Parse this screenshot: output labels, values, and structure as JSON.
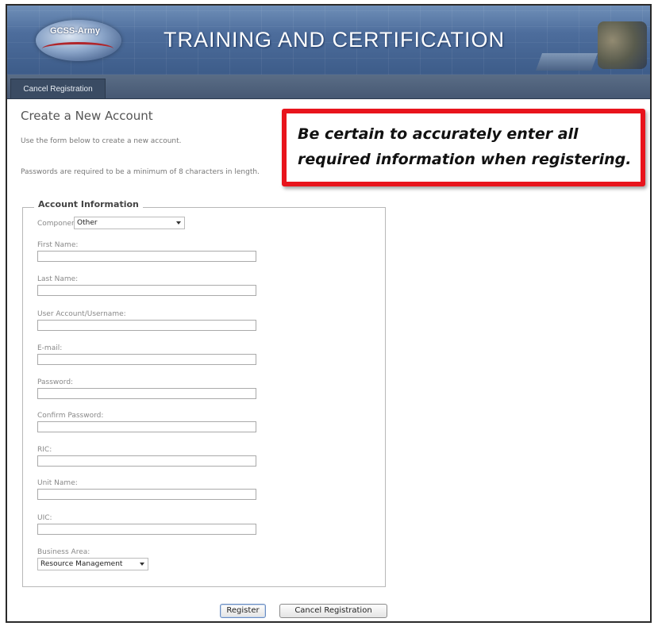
{
  "banner": {
    "logo_text": "GCSS-Army",
    "title": "TRAINING  AND CERTIFICATION"
  },
  "nav": {
    "cancel_tab": "Cancel Registration"
  },
  "page": {
    "title": "Create a New Account",
    "intro_line1": "Use the form below to create a new account.",
    "intro_line2": "Passwords are required to be a minimum of 8 characters in length."
  },
  "notice": {
    "line1": "Be certain to accurately enter all",
    "line2": "required information when registering.",
    "border_color": "#e8141c"
  },
  "form": {
    "legend": "Account Information",
    "component_label": "Component:",
    "component_value": "Other",
    "fields": {
      "first_name": "First Name:",
      "last_name": "Last Name:",
      "username": "User Account/Username:",
      "email": "E-mail:",
      "password": "Password:",
      "confirm_password": "Confirm Password:",
      "ric": "RIC:",
      "unit_name": "Unit Name:",
      "uic": "UIC:"
    },
    "business_area_label": "Business Area:",
    "business_area_value": "Resource Management",
    "register_button": "Register",
    "cancel_button": "Cancel Registration"
  }
}
